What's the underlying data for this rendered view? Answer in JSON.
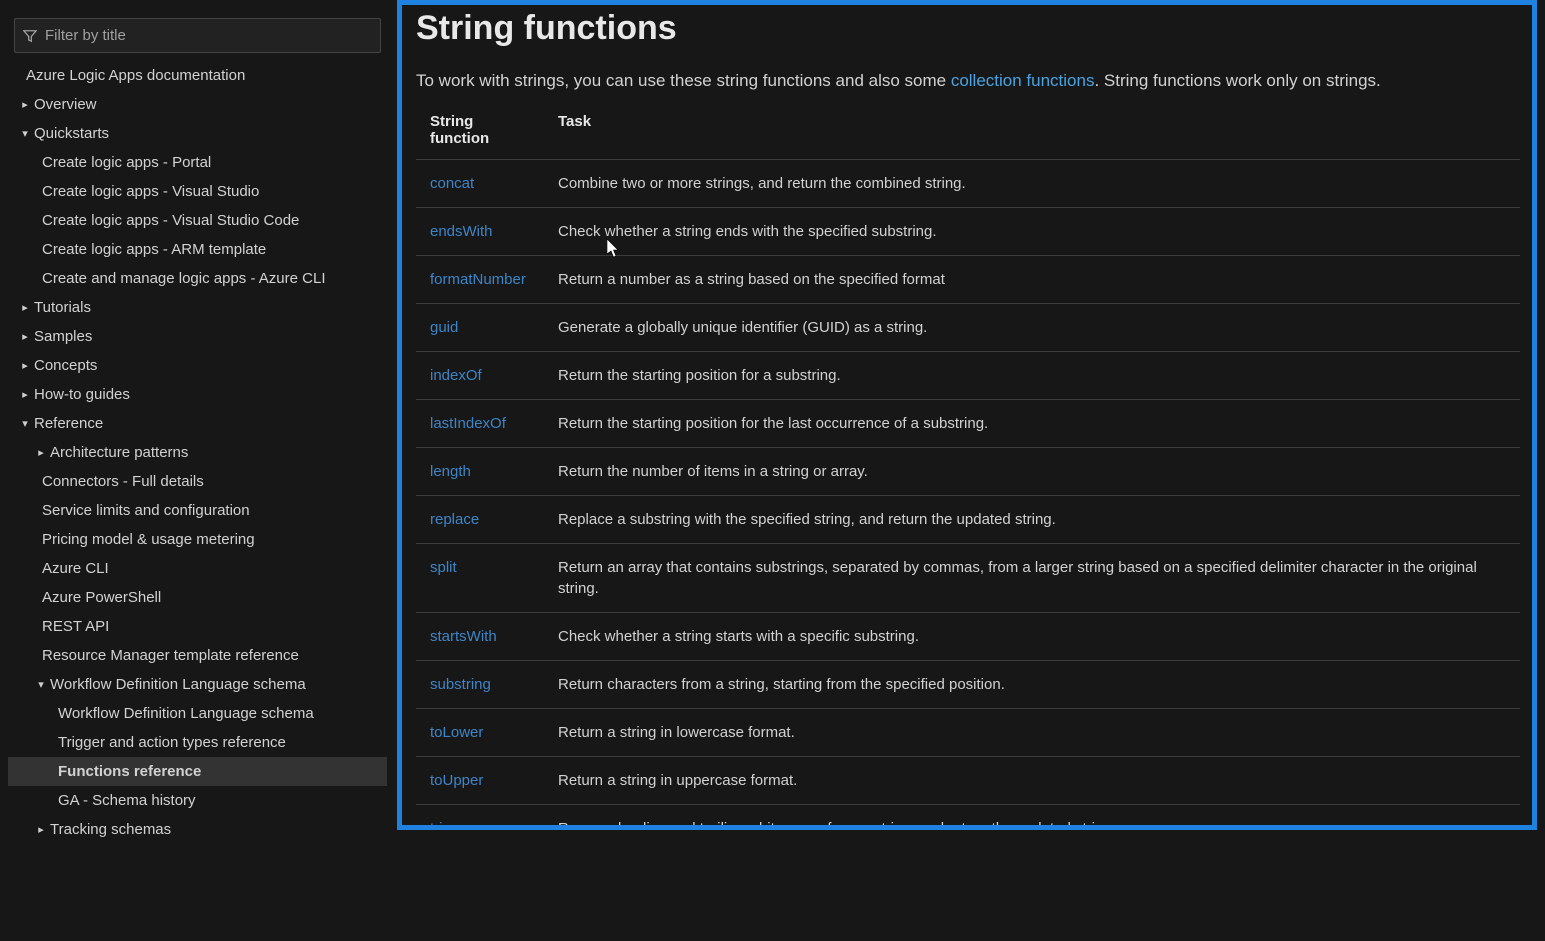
{
  "filter": {
    "placeholder": "Filter by title"
  },
  "nav": {
    "root": {
      "label": "Azure Logic Apps documentation"
    },
    "overview": {
      "label": "Overview"
    },
    "quickstarts": {
      "label": "Quickstarts",
      "items": [
        "Create logic apps - Portal",
        "Create logic apps - Visual Studio",
        "Create logic apps - Visual Studio Code",
        "Create logic apps - ARM template",
        "Create and manage logic apps - Azure CLI"
      ]
    },
    "tutorials": {
      "label": "Tutorials"
    },
    "samples": {
      "label": "Samples"
    },
    "concepts": {
      "label": "Concepts"
    },
    "howto": {
      "label": "How-to guides"
    },
    "reference": {
      "label": "Reference",
      "arch": {
        "label": "Architecture patterns"
      },
      "items_flat": [
        "Connectors - Full details",
        "Service limits and configuration",
        "Pricing model & usage metering",
        "Azure CLI",
        "Azure PowerShell",
        "REST API",
        "Resource Manager template reference"
      ],
      "wdls": {
        "label": "Workflow Definition Language schema",
        "items": [
          "Workflow Definition Language schema",
          "Trigger and action types reference",
          "Functions reference",
          "GA - Schema history"
        ]
      },
      "tracking": {
        "label": "Tracking schemas"
      }
    }
  },
  "page": {
    "title": "String functions",
    "intro_before": "To work with strings, you can use these string functions and also some ",
    "intro_link": "collection functions",
    "intro_after": ". String functions work only on strings."
  },
  "table": {
    "col1": "String function",
    "col2": "Task",
    "rows": [
      {
        "fn": "concat",
        "task": "Combine two or more strings, and return the combined string."
      },
      {
        "fn": "endsWith",
        "task": "Check whether a string ends with the specified substring."
      },
      {
        "fn": "formatNumber",
        "task": "Return a number as a string based on the specified format"
      },
      {
        "fn": "guid",
        "task": "Generate a globally unique identifier (GUID) as a string."
      },
      {
        "fn": "indexOf",
        "task": "Return the starting position for a substring."
      },
      {
        "fn": "lastIndexOf",
        "task": "Return the starting position for the last occurrence of a substring."
      },
      {
        "fn": "length",
        "task": "Return the number of items in a string or array."
      },
      {
        "fn": "replace",
        "task": "Replace a substring with the specified string, and return the updated string."
      },
      {
        "fn": "split",
        "task": "Return an array that contains substrings, separated by commas, from a larger string based on a specified delimiter character in the original string."
      },
      {
        "fn": "startsWith",
        "task": "Check whether a string starts with a specific substring."
      },
      {
        "fn": "substring",
        "task": "Return characters from a string, starting from the specified position."
      },
      {
        "fn": "toLower",
        "task": "Return a string in lowercase format."
      },
      {
        "fn": "toUpper",
        "task": "Return a string in uppercase format."
      },
      {
        "fn": "trim",
        "task": "Remove leading and trailing whitespace from a string, and return the updated string."
      }
    ]
  }
}
